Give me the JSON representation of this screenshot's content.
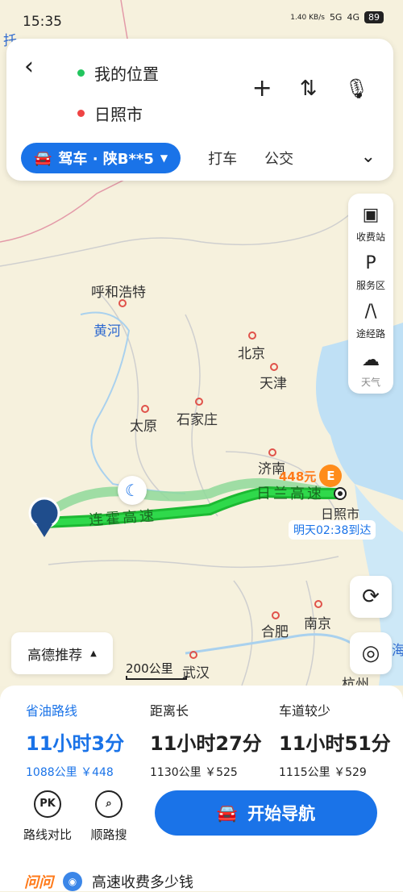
{
  "status": {
    "time": "15:35",
    "battery": "89",
    "network1": "5G",
    "network2": "4G",
    "speed": "1.40 KB/s"
  },
  "top": {
    "origin": "我的位置",
    "destination": "日照市",
    "add_icon": "plus-icon",
    "swap_icon": "swap-icon",
    "mic_icon": "mic-icon",
    "drive_label": "驾车 · 陕B**5",
    "tabs": [
      "打车",
      "公交"
    ]
  },
  "tools": [
    {
      "label": "收费站",
      "icon": "toll-icon"
    },
    {
      "label": "服务区",
      "icon": "service-area-icon"
    },
    {
      "label": "途经路",
      "icon": "road-icon"
    },
    {
      "label": "天气",
      "icon": "weather-icon"
    }
  ],
  "map": {
    "cities": [
      "呼和浩特",
      "北京",
      "天津",
      "太原",
      "石家庄",
      "济南",
      "合肥",
      "南京",
      "武汉",
      "杭州",
      "日照市"
    ],
    "river": "黄河",
    "edge_labels": [
      "托",
      "海"
    ],
    "highway1": "连霍高速",
    "highway2": "日兰高速",
    "toll_price": "448元",
    "arrival": "明天02:38到达"
  },
  "recommend": "高德推荐",
  "scale": "200公里",
  "routes": [
    {
      "tag": "省油路线",
      "time": "11小时3分",
      "meta": "1088公里 ￥448",
      "selected": true
    },
    {
      "tag": "距离长",
      "time": "11小时27分",
      "meta": "1130公里 ￥525",
      "selected": false
    },
    {
      "tag": "车道较少",
      "time": "11小时51分",
      "meta": "1115公里 ￥529",
      "selected": false
    }
  ],
  "actions": {
    "compare": "路线对比",
    "search": "顺路搜",
    "start": "开始导航"
  },
  "qa": {
    "brand": "问问",
    "question": "高速收费多少钱"
  },
  "colors": {
    "accent": "#1a73e8",
    "route": "#2ecc40",
    "origin_dot": "#22c55e",
    "dest_dot": "#ef4444"
  }
}
